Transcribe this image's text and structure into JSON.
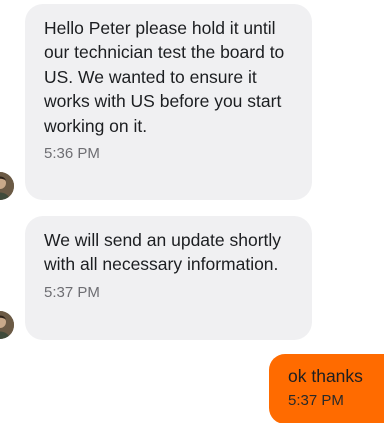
{
  "messages": [
    {
      "text": "Hello Peter please hold it until our technician test the board to US. We wanted to ensure it works with US before you start working on it.",
      "time": "5:36 PM"
    },
    {
      "text": "We will send an update shortly with all necessary information.",
      "time": "5:37 PM"
    },
    {
      "text": "ok thanks",
      "time": "5:37 PM"
    }
  ],
  "colors": {
    "incoming_bubble": "#f0f0f2",
    "outgoing_bubble": "#ff6b00",
    "timestamp": "#6e6e73"
  },
  "icons": {
    "sender_avatar": "avatar-photo"
  }
}
